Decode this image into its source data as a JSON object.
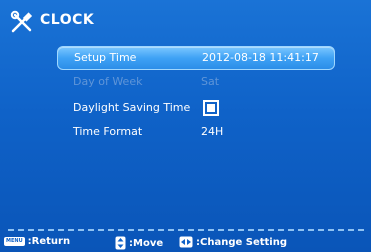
{
  "header": {
    "title": "CLOCK",
    "icon": "tools-icon"
  },
  "settings": [
    {
      "label": "Setup Time",
      "value": "2012-08-18 11:41:17",
      "state": "selected"
    },
    {
      "label": "Day of Week",
      "value": "Sat",
      "state": "disabled"
    },
    {
      "label": "Daylight Saving Time",
      "value": "",
      "control": "checkbox",
      "checked": false
    },
    {
      "label": "Time Format",
      "value": "24H"
    }
  ],
  "footer": {
    "return_key": "MENU",
    "return_label": ":Return",
    "move_label": ":Move",
    "change_label": ":Change Setting"
  },
  "colors": {
    "background": "#0f62c8",
    "selected_row": "#3fa2f5",
    "disabled_text": "#5f95d8",
    "text": "#ffffff"
  }
}
